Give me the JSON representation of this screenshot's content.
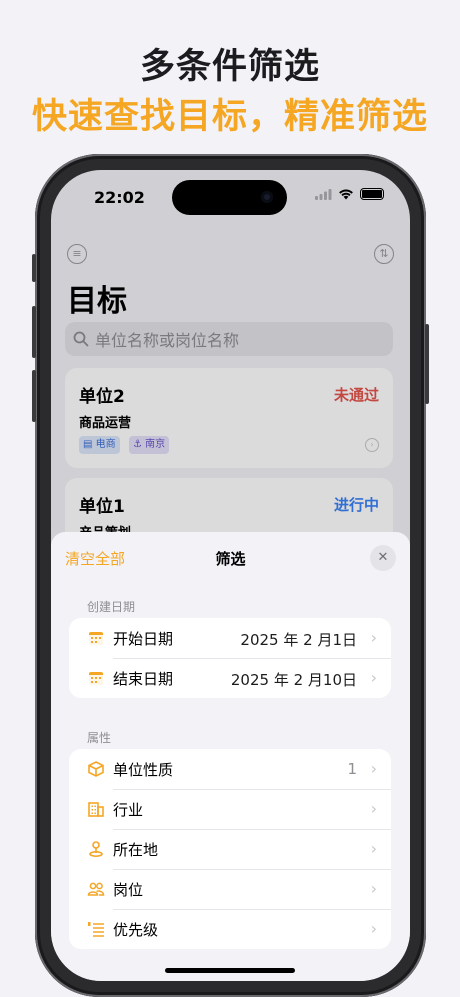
{
  "promo": {
    "headline": "多条件筛选",
    "subline": "快速查找目标，精准筛选"
  },
  "status_bar": {
    "time": "22:02"
  },
  "page": {
    "title": "目标",
    "search_placeholder": "单位名称或岗位名称"
  },
  "cards": [
    {
      "name": "单位2",
      "status": "未通过",
      "status_color": "#e5534b",
      "job": "商品运营",
      "tags": [
        "电商",
        "南京"
      ]
    },
    {
      "name": "单位1",
      "status": "进行中",
      "status_color": "#3b82f6",
      "job": "产品策划",
      "tags": []
    }
  ],
  "filter_sheet": {
    "clear_label": "清空全部",
    "title": "筛选",
    "close_icon": "xmark-icon",
    "date_section": {
      "label": "创建日期",
      "rows": [
        {
          "label": "开始日期",
          "value": "2025 年 2 月1日"
        },
        {
          "label": "结束日期",
          "value": "2025 年 2 月10日"
        }
      ]
    },
    "attr_section": {
      "label": "属性",
      "rows": [
        {
          "label": "单位性质",
          "value": "1",
          "icon": "cube-icon"
        },
        {
          "label": "行业",
          "value": "",
          "icon": "building-icon"
        },
        {
          "label": "所在地",
          "value": "",
          "icon": "location-pin-icon"
        },
        {
          "label": "岗位",
          "value": "",
          "icon": "people-icon"
        },
        {
          "label": "优先级",
          "value": "",
          "icon": "list-priority-icon"
        }
      ]
    }
  },
  "colors": {
    "accent": "#f5a623",
    "background": "#f2f2f7"
  }
}
